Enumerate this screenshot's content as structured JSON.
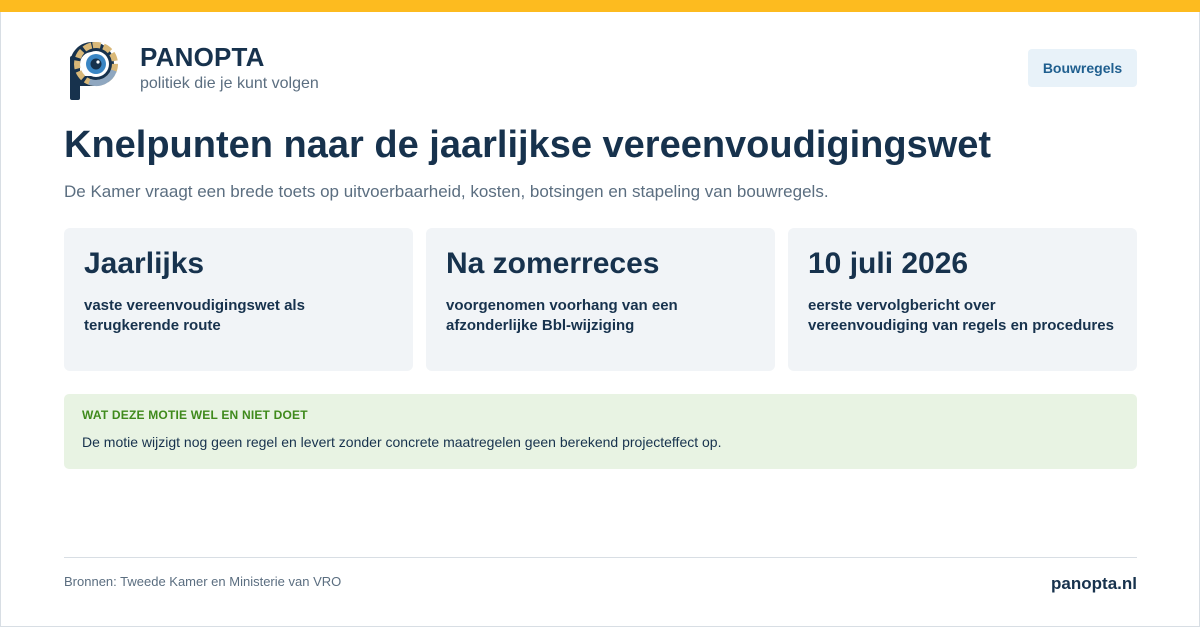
{
  "colors": {
    "accent_bar": "#fdbb1f",
    "brand_navy": "#17324d",
    "muted_text": "#5b6e80",
    "card_bg": "#f1f4f7",
    "tag_bg": "#e8f2f9",
    "tag_text": "#1f5f8f",
    "notice_bg": "#e8f3e3",
    "notice_label": "#3f8a1c"
  },
  "brand": {
    "logo_icon": "panopta-eye-logo-icon",
    "name": "PANOPTA",
    "tagline": "politiek die je kunt volgen"
  },
  "topic_tag": "Bouwregels",
  "headline": "Knelpunten naar de jaarlijkse vereenvoudigingswet",
  "subline": "De Kamer vraagt een brede toets op uitvoerbaarheid, kosten, botsingen en stapeling van bouwregels.",
  "cards": [
    {
      "big": "Jaarlijks",
      "small": "vaste vereenvoudigingswet als terugkerende route"
    },
    {
      "big": "Na zomerreces",
      "small": "voorgenomen voorhang van een afzonderlijke Bbl-wijziging"
    },
    {
      "big": "10 juli 2026",
      "small": "eerste vervolgbericht over vereenvoudiging van regels en procedures"
    }
  ],
  "notice": {
    "label": "WAT DEZE MOTIE WEL EN NIET DOET",
    "text": "De motie wijzigt nog geen regel en levert zonder concrete maatregelen geen berekend projecteffect op."
  },
  "footer": {
    "sources": "Bronnen: Tweede Kamer en Ministerie van VRO",
    "site": "panopta.nl"
  }
}
